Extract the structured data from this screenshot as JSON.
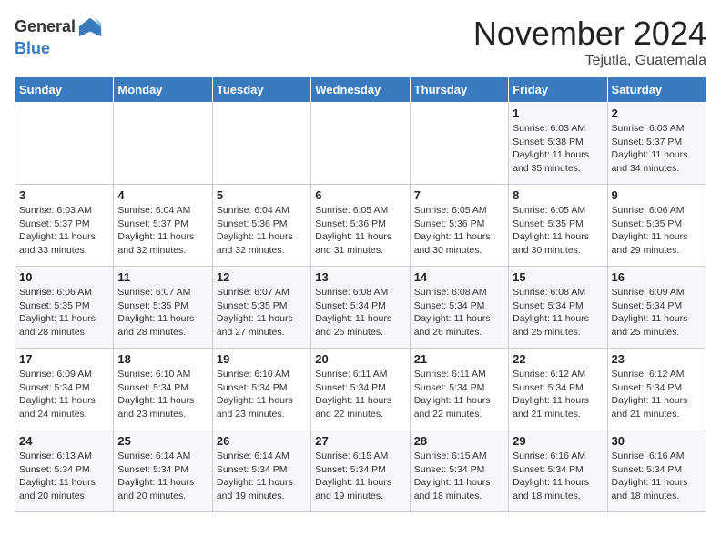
{
  "header": {
    "logo_line1": "General",
    "logo_line2": "Blue",
    "month": "November 2024",
    "location": "Tejutla, Guatemala"
  },
  "weekdays": [
    "Sunday",
    "Monday",
    "Tuesday",
    "Wednesday",
    "Thursday",
    "Friday",
    "Saturday"
  ],
  "weeks": [
    [
      {
        "day": "",
        "info": ""
      },
      {
        "day": "",
        "info": ""
      },
      {
        "day": "",
        "info": ""
      },
      {
        "day": "",
        "info": ""
      },
      {
        "day": "",
        "info": ""
      },
      {
        "day": "1",
        "info": "Sunrise: 6:03 AM\nSunset: 5:38 PM\nDaylight: 11 hours and 35 minutes."
      },
      {
        "day": "2",
        "info": "Sunrise: 6:03 AM\nSunset: 5:37 PM\nDaylight: 11 hours and 34 minutes."
      }
    ],
    [
      {
        "day": "3",
        "info": "Sunrise: 6:03 AM\nSunset: 5:37 PM\nDaylight: 11 hours and 33 minutes."
      },
      {
        "day": "4",
        "info": "Sunrise: 6:04 AM\nSunset: 5:37 PM\nDaylight: 11 hours and 32 minutes."
      },
      {
        "day": "5",
        "info": "Sunrise: 6:04 AM\nSunset: 5:36 PM\nDaylight: 11 hours and 32 minutes."
      },
      {
        "day": "6",
        "info": "Sunrise: 6:05 AM\nSunset: 5:36 PM\nDaylight: 11 hours and 31 minutes."
      },
      {
        "day": "7",
        "info": "Sunrise: 6:05 AM\nSunset: 5:36 PM\nDaylight: 11 hours and 30 minutes."
      },
      {
        "day": "8",
        "info": "Sunrise: 6:05 AM\nSunset: 5:35 PM\nDaylight: 11 hours and 30 minutes."
      },
      {
        "day": "9",
        "info": "Sunrise: 6:06 AM\nSunset: 5:35 PM\nDaylight: 11 hours and 29 minutes."
      }
    ],
    [
      {
        "day": "10",
        "info": "Sunrise: 6:06 AM\nSunset: 5:35 PM\nDaylight: 11 hours and 28 minutes."
      },
      {
        "day": "11",
        "info": "Sunrise: 6:07 AM\nSunset: 5:35 PM\nDaylight: 11 hours and 28 minutes."
      },
      {
        "day": "12",
        "info": "Sunrise: 6:07 AM\nSunset: 5:35 PM\nDaylight: 11 hours and 27 minutes."
      },
      {
        "day": "13",
        "info": "Sunrise: 6:08 AM\nSunset: 5:34 PM\nDaylight: 11 hours and 26 minutes."
      },
      {
        "day": "14",
        "info": "Sunrise: 6:08 AM\nSunset: 5:34 PM\nDaylight: 11 hours and 26 minutes."
      },
      {
        "day": "15",
        "info": "Sunrise: 6:08 AM\nSunset: 5:34 PM\nDaylight: 11 hours and 25 minutes."
      },
      {
        "day": "16",
        "info": "Sunrise: 6:09 AM\nSunset: 5:34 PM\nDaylight: 11 hours and 25 minutes."
      }
    ],
    [
      {
        "day": "17",
        "info": "Sunrise: 6:09 AM\nSunset: 5:34 PM\nDaylight: 11 hours and 24 minutes."
      },
      {
        "day": "18",
        "info": "Sunrise: 6:10 AM\nSunset: 5:34 PM\nDaylight: 11 hours and 23 minutes."
      },
      {
        "day": "19",
        "info": "Sunrise: 6:10 AM\nSunset: 5:34 PM\nDaylight: 11 hours and 23 minutes."
      },
      {
        "day": "20",
        "info": "Sunrise: 6:11 AM\nSunset: 5:34 PM\nDaylight: 11 hours and 22 minutes."
      },
      {
        "day": "21",
        "info": "Sunrise: 6:11 AM\nSunset: 5:34 PM\nDaylight: 11 hours and 22 minutes."
      },
      {
        "day": "22",
        "info": "Sunrise: 6:12 AM\nSunset: 5:34 PM\nDaylight: 11 hours and 21 minutes."
      },
      {
        "day": "23",
        "info": "Sunrise: 6:12 AM\nSunset: 5:34 PM\nDaylight: 11 hours and 21 minutes."
      }
    ],
    [
      {
        "day": "24",
        "info": "Sunrise: 6:13 AM\nSunset: 5:34 PM\nDaylight: 11 hours and 20 minutes."
      },
      {
        "day": "25",
        "info": "Sunrise: 6:14 AM\nSunset: 5:34 PM\nDaylight: 11 hours and 20 minutes."
      },
      {
        "day": "26",
        "info": "Sunrise: 6:14 AM\nSunset: 5:34 PM\nDaylight: 11 hours and 19 minutes."
      },
      {
        "day": "27",
        "info": "Sunrise: 6:15 AM\nSunset: 5:34 PM\nDaylight: 11 hours and 19 minutes."
      },
      {
        "day": "28",
        "info": "Sunrise: 6:15 AM\nSunset: 5:34 PM\nDaylight: 11 hours and 18 minutes."
      },
      {
        "day": "29",
        "info": "Sunrise: 6:16 AM\nSunset: 5:34 PM\nDaylight: 11 hours and 18 minutes."
      },
      {
        "day": "30",
        "info": "Sunrise: 6:16 AM\nSunset: 5:34 PM\nDaylight: 11 hours and 18 minutes."
      }
    ]
  ]
}
